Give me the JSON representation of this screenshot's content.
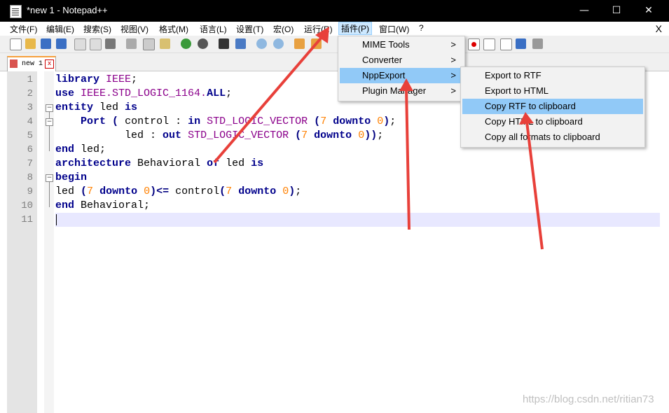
{
  "window": {
    "title": "*new 1 - Notepad++",
    "minimize": "—",
    "maximize": "☐",
    "close": "✕"
  },
  "menubar": {
    "items": [
      "文件(F)",
      "编辑(E)",
      "搜索(S)",
      "视图(V)",
      "格式(M)",
      "语言(L)",
      "设置(T)",
      "宏(O)",
      "运行(R)",
      "插件(P)",
      "窗口(W)",
      "?"
    ],
    "close": "X"
  },
  "tab": {
    "label": "new 1",
    "close": "x"
  },
  "editor": {
    "line_numbers": [
      "1",
      "2",
      "3",
      "4",
      "5",
      "6",
      "7",
      "8",
      "9",
      "10",
      "11"
    ]
  },
  "plugins_menu": {
    "items": [
      {
        "label": "MIME Tools",
        "arrow": ">"
      },
      {
        "label": "Converter",
        "arrow": ">"
      },
      {
        "label": "NppExport",
        "arrow": ">"
      },
      {
        "label": "Plugin Manager",
        "arrow": ">"
      }
    ]
  },
  "nppexport_menu": {
    "items": [
      "Export to RTF",
      "Export to HTML",
      "Copy RTF to clipboard",
      "Copy HTML to clipboard",
      "Copy all formats to clipboard"
    ]
  },
  "watermark": "https://blog.csdn.net/ritian73",
  "colors": {
    "accent": "#91c9f7",
    "arrow": "#e8403a",
    "keyword": "#00008b",
    "type": "#8b008b",
    "number": "#ff8000"
  }
}
